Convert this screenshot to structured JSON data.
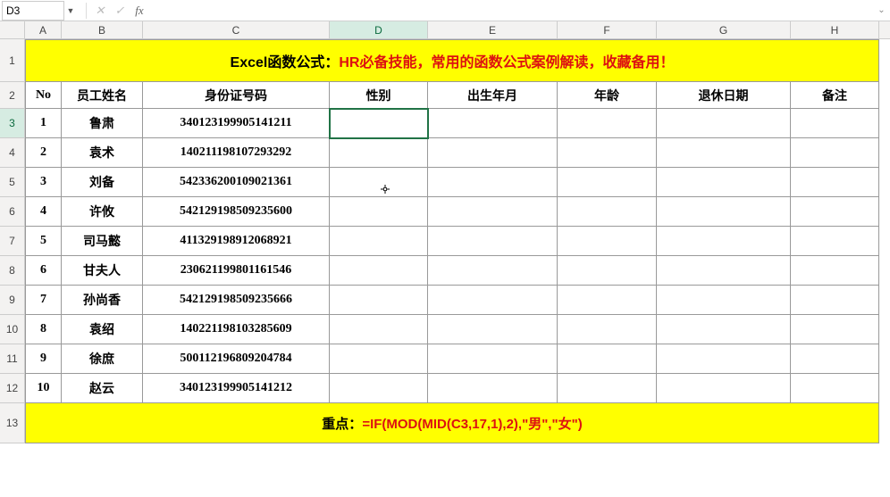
{
  "chart_data": {
    "type": "table",
    "title": "Excel函数公式：HR必备技能，常用的函数公式案例解读，收藏备用！",
    "columns": [
      "No",
      "员工姓名",
      "身份证号码",
      "性别",
      "出生年月",
      "年龄",
      "退休日期",
      "备注"
    ],
    "rows": [
      {
        "no": 1,
        "name": "鲁肃",
        "id": "340123199905141211",
        "gender": "",
        "birth": "",
        "age": "",
        "retire": "",
        "note": ""
      },
      {
        "no": 2,
        "name": "袁术",
        "id": "140211198107293292",
        "gender": "",
        "birth": "",
        "age": "",
        "retire": "",
        "note": ""
      },
      {
        "no": 3,
        "name": "刘备",
        "id": "542336200109021361",
        "gender": "",
        "birth": "",
        "age": "",
        "retire": "",
        "note": ""
      },
      {
        "no": 4,
        "name": "许攸",
        "id": "542129198509235600",
        "gender": "",
        "birth": "",
        "age": "",
        "retire": "",
        "note": ""
      },
      {
        "no": 5,
        "name": "司马懿",
        "id": "411329198912068921",
        "gender": "",
        "birth": "",
        "age": "",
        "retire": "",
        "note": ""
      },
      {
        "no": 6,
        "name": "甘夫人",
        "id": "230621199801161546",
        "gender": "",
        "birth": "",
        "age": "",
        "retire": "",
        "note": ""
      },
      {
        "no": 7,
        "name": "孙尚香",
        "id": "542129198509235666",
        "gender": "",
        "birth": "",
        "age": "",
        "retire": "",
        "note": ""
      },
      {
        "no": 8,
        "name": "袁绍",
        "id": "140221198103285609",
        "gender": "",
        "birth": "",
        "age": "",
        "retire": "",
        "note": ""
      },
      {
        "no": 9,
        "name": "徐庶",
        "id": "500112196809204784",
        "gender": "",
        "birth": "",
        "age": "",
        "retire": "",
        "note": ""
      },
      {
        "no": 10,
        "name": "赵云",
        "id": "340123199905141212",
        "gender": "",
        "birth": "",
        "age": "",
        "retire": "",
        "note": ""
      }
    ],
    "footer": "重点：=IF(MOD(MID(C3,17,1),2),\"男\",\"女\")"
  },
  "formula_bar": {
    "cell_ref": "D3",
    "formula": "",
    "cancel_glyph": "✕",
    "enter_glyph": "✓",
    "fx_glyph": "fx",
    "expand_glyph": "⌄",
    "dropdown_glyph": "▼"
  },
  "columns": [
    "A",
    "B",
    "C",
    "D",
    "E",
    "F",
    "G",
    "H"
  ],
  "content": {
    "title_prefix": "Excel函数公式：",
    "title_red": "HR必备技能，常用的函数公式案例解读，收藏备用！",
    "headers": {
      "A": "No",
      "B": "员工姓名",
      "C": "身份证号码",
      "D": "性别",
      "E": "出生年月",
      "F": "年龄",
      "G": "退休日期",
      "H": "备注"
    },
    "data": [
      {
        "no": "1",
        "name": "鲁肃",
        "id": "340123199905141211"
      },
      {
        "no": "2",
        "name": "袁术",
        "id": "140211198107293292"
      },
      {
        "no": "3",
        "name": "刘备",
        "id": "542336200109021361"
      },
      {
        "no": "4",
        "name": "许攸",
        "id": "542129198509235600"
      },
      {
        "no": "5",
        "name": "司马懿",
        "id": "411329198912068921"
      },
      {
        "no": "6",
        "name": "甘夫人",
        "id": "230621199801161546"
      },
      {
        "no": "7",
        "name": "孙尚香",
        "id": "542129198509235666"
      },
      {
        "no": "8",
        "name": "袁绍",
        "id": "140221198103285609"
      },
      {
        "no": "9",
        "name": "徐庶",
        "id": "500112196809204784"
      },
      {
        "no": "10",
        "name": "赵云",
        "id": "340123199905141212"
      }
    ],
    "footer_prefix": "重点：",
    "footer_red": "=IF(MOD(MID(C3,17,1),2),\"男\",\"女\")"
  }
}
